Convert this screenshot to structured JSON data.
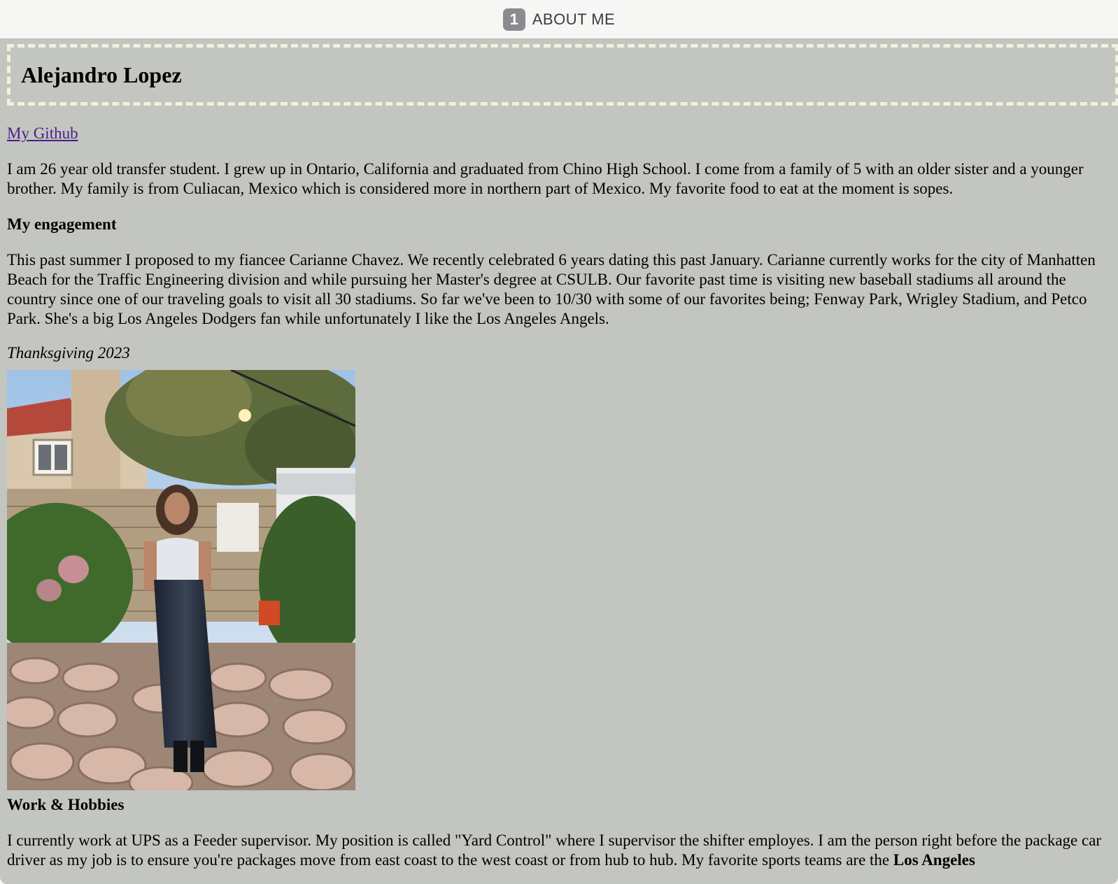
{
  "tab": {
    "number": "1",
    "title": "ABOUT ME"
  },
  "header": {
    "name": "Alejandro Lopez"
  },
  "links": {
    "github": "My Github"
  },
  "intro": "I am 26 year old transfer student. I grew up in Ontario, California and graduated from Chino High School. I come from a family of 5 with an older sister and a younger brother. My family is from Culiacan, Mexico which is considered more in northern part of Mexico. My favorite food to eat at the moment is sopes.",
  "engagement": {
    "heading": "My engagement",
    "text": "This past summer I proposed to my fiancee Carianne Chavez. We recently celebrated 6 years dating this past January. Carianne currently works for the city of Manhatten Beach for the Traffic Engineering division and while pursuing her Master's degree at CSULB. Our favorite past time is visiting new baseball stadiums all around the country since one of our traveling goals to visit all 30 stadiums. So far we've been to 10/30 with some of our favorites being; Fenway Park, Wrigley Stadium, and Petco Park. She's a big Los Angeles Dodgers fan while unfortunately I like the Los Angeles Angels.",
    "photo_caption": "Thanksgiving 2023"
  },
  "work": {
    "heading": "Work & Hobbies",
    "text": "I currently work at UPS as a Feeder supervisor. My position is called \"Yard Control\" where I supervisor the shifter employes. I am the person right before the package car driver as my job is to ensure you're packages move from east coast to the west coast or from hub to hub. My favorite sports teams are the ",
    "text_bold": "Los Angeles"
  },
  "colors": {
    "page_bg": "#c3c5c1",
    "header_border": "#f2f1dc",
    "link": "#4a1d8c",
    "tab_badge": "#8a8b8f"
  }
}
